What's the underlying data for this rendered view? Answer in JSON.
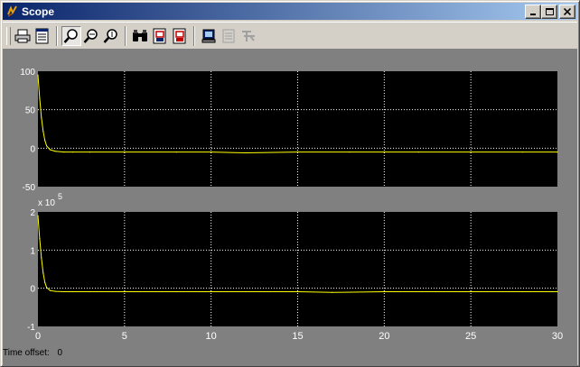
{
  "window": {
    "title": "Scope",
    "buttons": {
      "minimize": "_",
      "maximize": "□",
      "close": "×"
    }
  },
  "toolbar": {
    "buttons": [
      {
        "name": "print-button",
        "icon": "printer-icon"
      },
      {
        "name": "parameters-button",
        "icon": "parameters-icon"
      },
      {
        "name": "zoom-button",
        "icon": "zoom-icon",
        "pressed": true
      },
      {
        "name": "zoom-x-button",
        "icon": "zoom-x-icon"
      },
      {
        "name": "zoom-y-button",
        "icon": "zoom-y-icon"
      },
      {
        "name": "autoscale-button",
        "icon": "binoculars-icon"
      },
      {
        "name": "save-axes-button",
        "icon": "save-axes-icon"
      },
      {
        "name": "restore-axes-button",
        "icon": "restore-axes-icon"
      },
      {
        "name": "floating-scope-button",
        "icon": "floating-scope-icon"
      },
      {
        "name": "lock-axes-button",
        "icon": "lock-axes-icon",
        "disabled": true
      },
      {
        "name": "signal-selector-button",
        "icon": "signal-selector-icon",
        "disabled": true
      }
    ]
  },
  "status": {
    "label": "Time offset:",
    "value": "0"
  },
  "colors": {
    "plot_bg": "#000000",
    "trace": "#ffff00",
    "grid": "#ffffff",
    "frame": "#808080"
  },
  "chart_data": [
    {
      "type": "line",
      "xlim": [
        0,
        30
      ],
      "ylim": [
        -50,
        100
      ],
      "xticks": [
        0,
        5,
        10,
        15,
        20,
        25,
        30
      ],
      "yticks": [
        -50,
        0,
        50,
        100
      ],
      "ytick_labels": [
        "-50",
        "0",
        "50",
        "100"
      ],
      "show_xtick_labels": false,
      "multiplier": "",
      "grid": true,
      "x": [
        0,
        0.1,
        0.2,
        0.3,
        0.4,
        0.5,
        0.7,
        1,
        1.5,
        2,
        3,
        5,
        8,
        10,
        12,
        15,
        18,
        20,
        22,
        25,
        28,
        30
      ],
      "y": [
        95,
        65,
        40,
        22,
        10,
        3,
        -2,
        -4,
        -5,
        -5,
        -5,
        -5,
        -5,
        -5,
        -6,
        -5,
        -5,
        -5,
        -5,
        -5,
        -5,
        -5
      ]
    },
    {
      "type": "line",
      "xlim": [
        0,
        30
      ],
      "ylim": [
        -1,
        2
      ],
      "xticks": [
        0,
        5,
        10,
        15,
        20,
        25,
        30
      ],
      "yticks": [
        -1,
        0,
        1,
        2
      ],
      "ytick_labels": [
        "-1",
        "0",
        "1",
        "2"
      ],
      "xtick_labels": [
        "0",
        "5",
        "10",
        "15",
        "20",
        "25",
        "30"
      ],
      "show_xtick_labels": true,
      "multiplier": "x 10",
      "multiplier_exp": "5",
      "grid": true,
      "x": [
        0,
        0.1,
        0.2,
        0.3,
        0.4,
        0.5,
        0.7,
        1,
        1.5,
        2,
        3,
        5,
        8,
        10,
        12,
        15,
        17,
        20,
        23,
        25,
        28,
        30
      ],
      "y": [
        1.9,
        1.3,
        0.8,
        0.4,
        0.15,
        0.02,
        -0.06,
        -0.08,
        -0.09,
        -0.09,
        -0.09,
        -0.09,
        -0.09,
        -0.09,
        -0.09,
        -0.09,
        -0.11,
        -0.09,
        -0.09,
        -0.09,
        -0.09,
        -0.09
      ]
    }
  ]
}
